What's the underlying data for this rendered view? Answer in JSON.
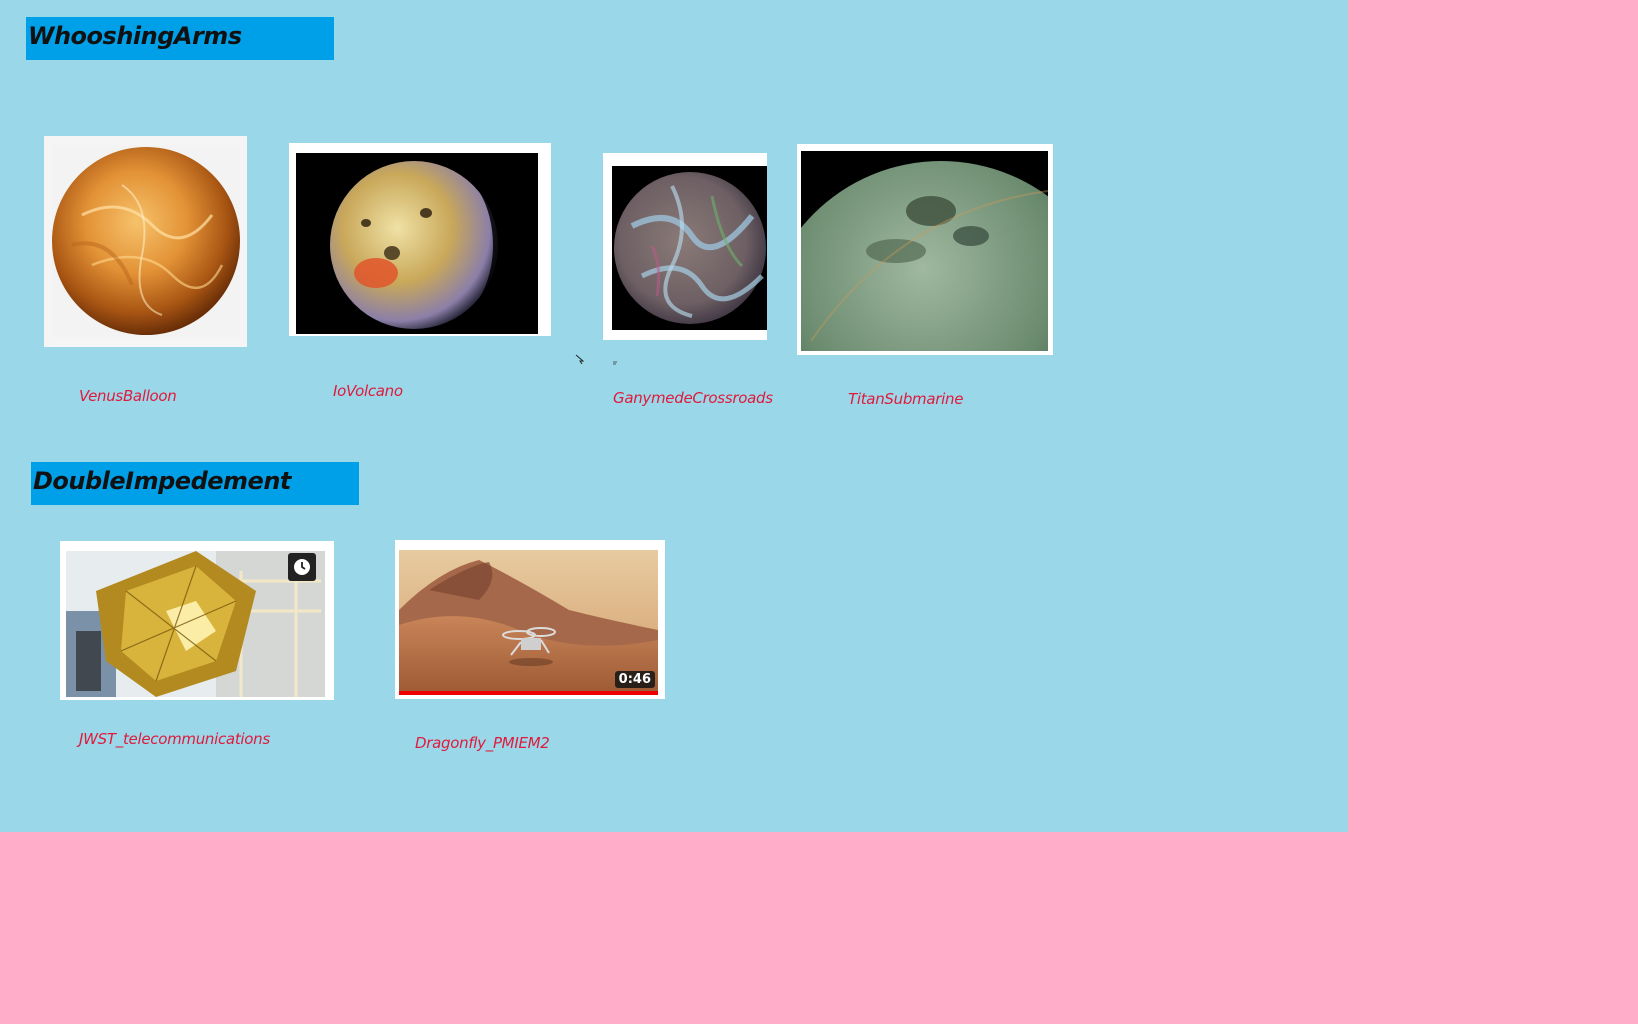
{
  "sections": [
    {
      "title": "WhooshingArms",
      "items": [
        {
          "caption": "VenusBalloon"
        },
        {
          "caption": "IoVolcano"
        },
        {
          "caption": "GanymedeCrossroads"
        },
        {
          "caption": "TitanSubmarine"
        }
      ]
    },
    {
      "title": "DoubleImpedement",
      "items": [
        {
          "caption": "JWST_telecommunications",
          "overlay_icon": "clock-icon"
        },
        {
          "caption": "Dragonfly_PMIEM2",
          "duration": "0:46",
          "progress": 1.0
        }
      ]
    }
  ],
  "colors": {
    "canvas": "#9ad8e9",
    "page": "#ffadc8",
    "title_bar": "#00a0e9",
    "caption": "#e01a3c"
  }
}
